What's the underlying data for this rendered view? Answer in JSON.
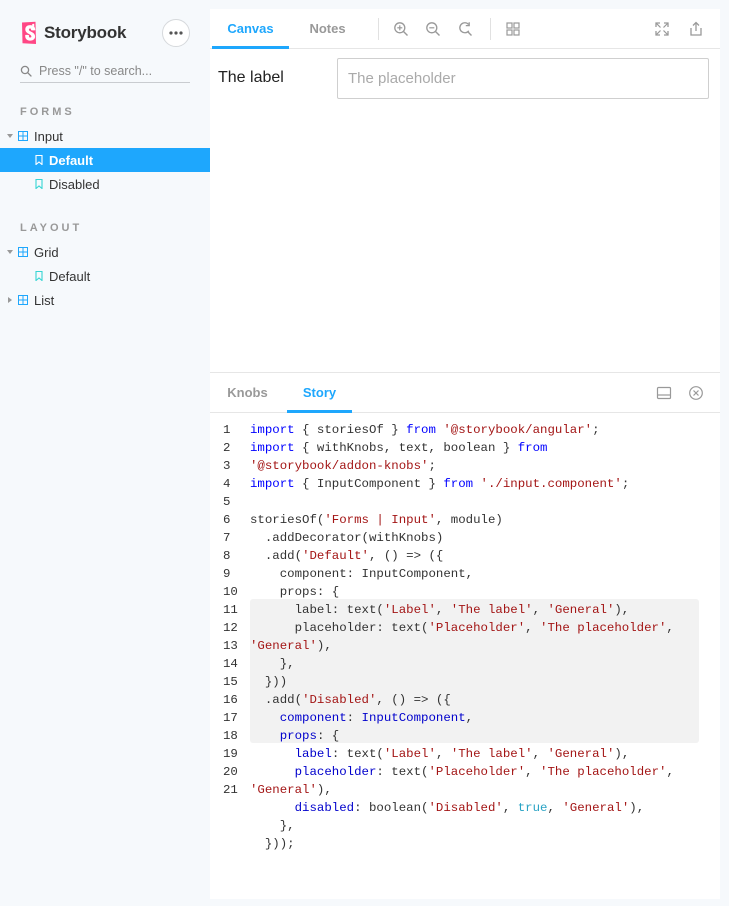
{
  "sidebar": {
    "brand": "Storybook",
    "search_placeholder": "Press \"/\" to search...",
    "sections": [
      {
        "title": "FORMS",
        "items": [
          {
            "label": "Input",
            "kind": "component",
            "expanded": true
          },
          {
            "label": "Default",
            "kind": "story",
            "selected": true
          },
          {
            "label": "Disabled",
            "kind": "story"
          }
        ]
      },
      {
        "title": "LAYOUT",
        "items": [
          {
            "label": "Grid",
            "kind": "component",
            "expanded": true
          },
          {
            "label": "Default",
            "kind": "story"
          },
          {
            "label": "List",
            "kind": "component",
            "expanded": false
          }
        ]
      }
    ]
  },
  "preview": {
    "tabs": [
      "Canvas",
      "Notes"
    ],
    "active_tab": "Canvas",
    "component": {
      "label": "The label",
      "placeholder": "The placeholder"
    }
  },
  "addons": {
    "tabs": [
      "Knobs",
      "Story"
    ],
    "active_tab": "Story",
    "code_line_numbers": [
      "1",
      "2",
      "3",
      "4",
      "5",
      "6",
      "7",
      "8",
      "9",
      "10",
      "11",
      "12",
      "13",
      "14",
      "15",
      "16",
      "17",
      "18",
      "19",
      "20",
      "21"
    ],
    "code_lines": [
      "import { storiesOf } from '@storybook/angular';",
      "import { withKnobs, text, boolean } from",
      "'@storybook/addon-knobs';",
      "import { InputComponent } from './input.component';",
      "",
      "storiesOf('Forms | Input', module)",
      "  .addDecorator(withKnobs)",
      "  .add('Default', () => ({",
      "    component: InputComponent,",
      "    props: {",
      "      label: text('Label', 'The label', 'General'),",
      "      placeholder: text('Placeholder', 'The placeholder',",
      "'General'),",
      "    },",
      "  }))",
      "  .add('Disabled', () => ({",
      "    component: InputComponent,",
      "    props: {",
      "      label: text('Label', 'The label', 'General'),",
      "      placeholder: text('Placeholder', 'The placeholder',",
      "'General'),",
      "      disabled: boolean('Disabled', true, 'General'),",
      "    },",
      "  }));"
    ]
  },
  "colors": {
    "accent": "#1ea7fd",
    "brand": "#ff4785"
  }
}
